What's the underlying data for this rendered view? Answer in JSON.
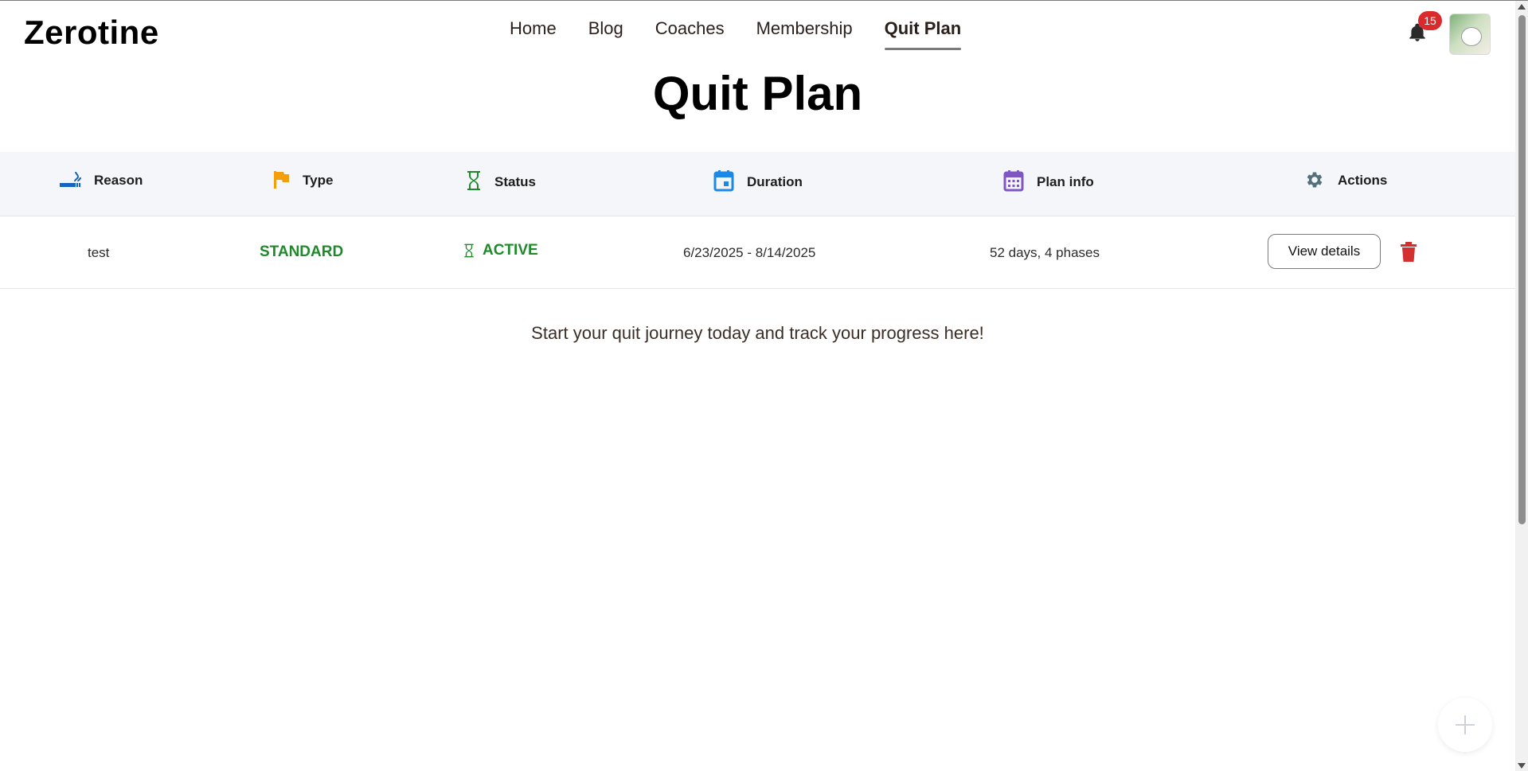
{
  "app": {
    "brand": "Zerotine"
  },
  "nav": {
    "items": [
      {
        "label": "Home"
      },
      {
        "label": "Blog"
      },
      {
        "label": "Coaches"
      },
      {
        "label": "Membership"
      },
      {
        "label": "Quit Plan",
        "active": true
      }
    ]
  },
  "notifications": {
    "count": "15",
    "icon": "bell-icon"
  },
  "user": {
    "avatar_icon": "avatar"
  },
  "page": {
    "title": "Quit Plan"
  },
  "table": {
    "headers": [
      {
        "label": "Reason",
        "icon": "smoking-icon",
        "color": "#1565c0"
      },
      {
        "label": "Type",
        "icon": "flag-icon",
        "color": "#f59e0b"
      },
      {
        "label": "Status",
        "icon": "hourglass-icon",
        "color": "#1e8a2a"
      },
      {
        "label": "Duration",
        "icon": "calendar-icon",
        "color": "#1e88e5"
      },
      {
        "label": "Plan info",
        "icon": "calendar-grid-icon",
        "color": "#7e57c2"
      },
      {
        "label": "Actions",
        "icon": "gear-icon",
        "color": "#546e7a"
      }
    ],
    "rows": [
      {
        "reason": "test",
        "type": "STANDARD",
        "status": "ACTIVE",
        "duration": "6/23/2025 - 8/14/2025",
        "plan_info": "52 days, 4 phases",
        "view_label": "View details"
      }
    ]
  },
  "empty_message": "Start your quit journey today and track your progress here!",
  "colors": {
    "accent_green": "#1e8a2a",
    "danger": "#d32f2f",
    "badge": "#d92b2b"
  }
}
